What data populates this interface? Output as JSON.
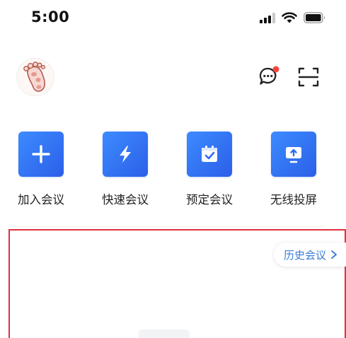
{
  "status_bar": {
    "time": "5:00",
    "icons": [
      "signal-icon",
      "wifi-icon",
      "battery-icon"
    ]
  },
  "header": {
    "avatar_icon": "footprint-avatar-icon",
    "message_icon": "message-icon",
    "message_has_badge": true,
    "scan_icon": "scan-icon",
    "badge_color": "#f2453d"
  },
  "quick_actions": [
    {
      "label": "加入会议",
      "icon": "plus-icon"
    },
    {
      "label": "快速会议",
      "icon": "lightning-icon"
    },
    {
      "label": "预定会议",
      "icon": "calendar-check-icon"
    },
    {
      "label": "无线投屏",
      "icon": "screen-share-icon"
    }
  ],
  "history": {
    "label": "历史会议",
    "icon": "chevron-right-icon"
  },
  "colors": {
    "accent": "#2f6df0",
    "history_text": "#3a7bd5",
    "highlight_border": "#e0323c"
  }
}
